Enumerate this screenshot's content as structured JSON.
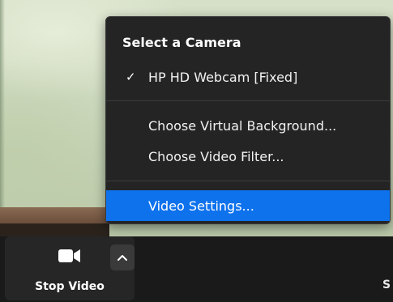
{
  "toolbar": {
    "stop_video_label": "Stop Video",
    "right_edge_text": "S"
  },
  "menu": {
    "heading": "Select a Camera",
    "camera": {
      "label": "HP HD Webcam [Fixed]",
      "checked": true,
      "check_glyph": "✓"
    },
    "items": [
      {
        "label": "Choose Virtual Background..."
      },
      {
        "label": "Choose Video Filter..."
      }
    ],
    "settings": {
      "label": "Video Settings...",
      "highlighted": true
    }
  },
  "colors": {
    "highlight": "#0e72ed",
    "menu_bg": "#242424",
    "toolbar_bg": "#1a1a1a"
  },
  "icons": {
    "camera": "video-camera-icon",
    "chevron": "chevron-up-icon",
    "check": "checkmark-icon"
  }
}
